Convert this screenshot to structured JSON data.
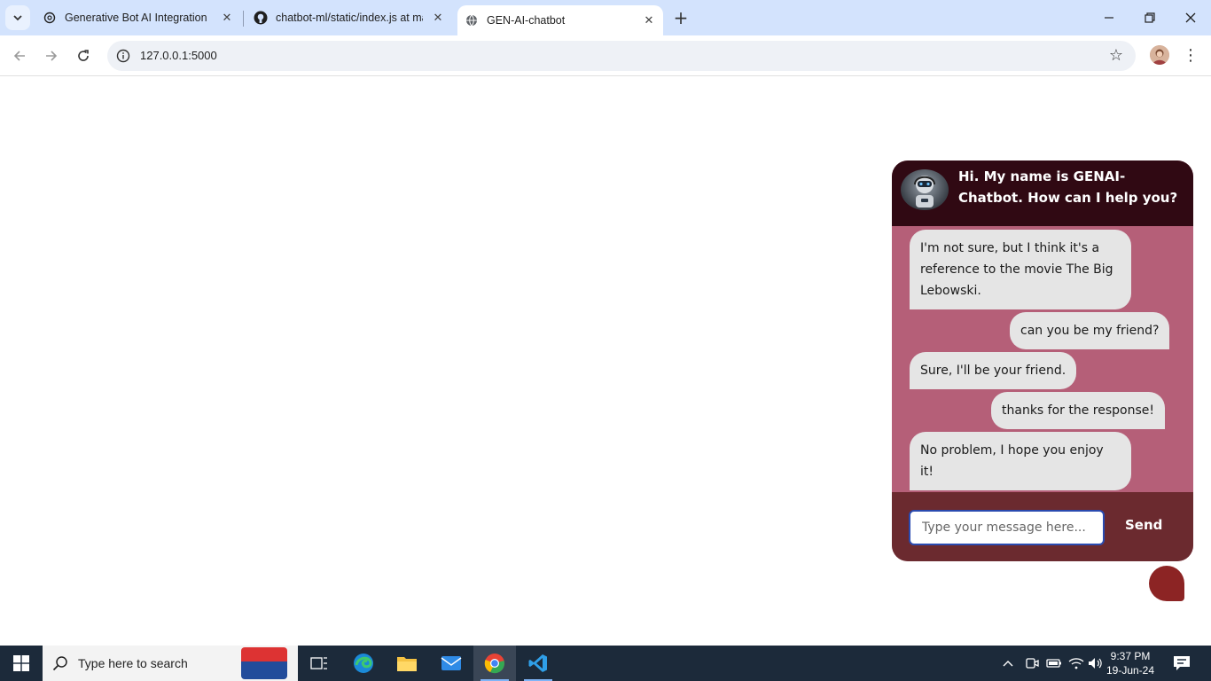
{
  "browser": {
    "tabs": [
      {
        "title": "Generative Bot AI Integration",
        "active": false
      },
      {
        "title": "chatbot-ml/static/index.js at ma",
        "active": false
      },
      {
        "title": "GEN-AI-chatbot",
        "active": true
      }
    ],
    "url": "127.0.0.1:5000"
  },
  "chat": {
    "header": "Hi. My name is GENAI-Chatbot. How can I help you?",
    "messages": [
      {
        "role": "bot",
        "text": "I'm not sure, but I think it's a reference to the movie The Big Lebowski."
      },
      {
        "role": "user",
        "text": "can you be my friend?"
      },
      {
        "role": "bot",
        "text": "Sure, I'll be your friend."
      },
      {
        "role": "user",
        "text": "thanks for the response!"
      },
      {
        "role": "bot",
        "text": "No problem, I hope you enjoy it!"
      }
    ],
    "input_placeholder": "Type your message here...",
    "send_label": "Send",
    "colors": {
      "header": "#300913",
      "body": "#b55f78",
      "footer": "#6b2a2f",
      "toggle": "#8c2424"
    }
  },
  "taskbar": {
    "search_placeholder": "Type here to search",
    "time": "9:37 PM",
    "date": "19-Jun-24"
  }
}
